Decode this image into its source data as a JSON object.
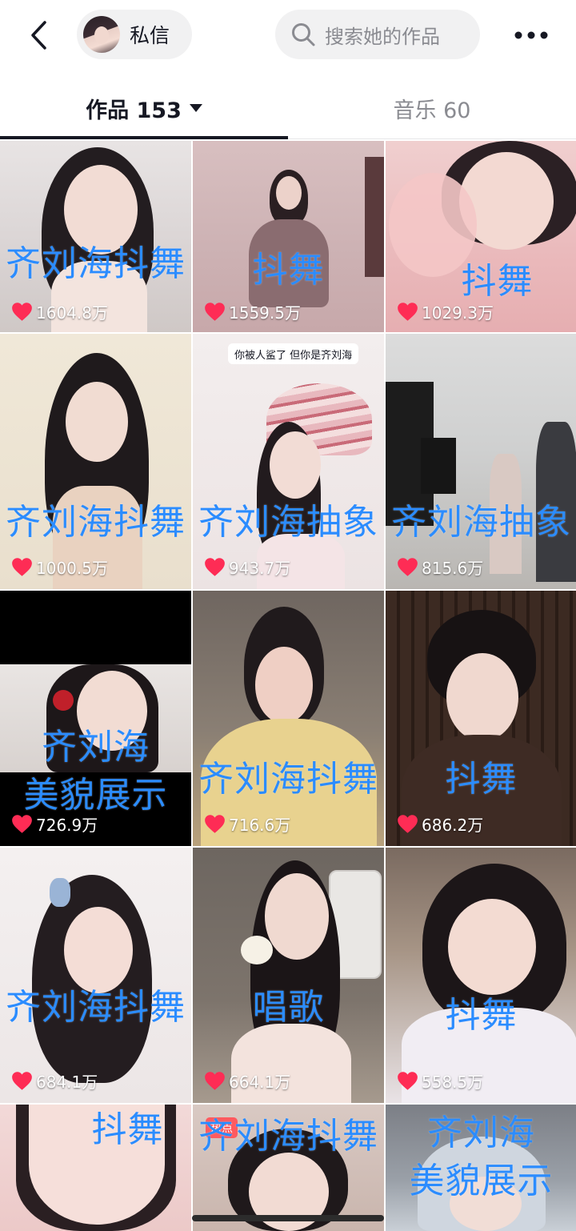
{
  "header": {
    "back_icon": "chevron-left-icon",
    "message_label": "私信",
    "search_placeholder": "搜索她的作品",
    "more_icon": "more-dots-icon"
  },
  "tabs": [
    {
      "label": "作品 153",
      "active": true
    },
    {
      "label": "音乐 60",
      "active": false
    }
  ],
  "colors": {
    "caption_blue": "#2b8cff",
    "heart_red": "#fe2c55",
    "text_primary": "#161823",
    "text_secondary": "#8a8b91"
  },
  "videos": [
    {
      "caption": "齐刘海抖舞",
      "likes": "1604.8万"
    },
    {
      "caption": "抖舞",
      "likes": "1559.5万"
    },
    {
      "caption": "抖舞",
      "likes": "1029.3万"
    },
    {
      "caption": "齐刘海抖舞",
      "likes": "1000.5万"
    },
    {
      "caption": "齐刘海抽象",
      "likes": "943.7万",
      "overlay_text": "你被人鲨了 但你是齐刘海"
    },
    {
      "caption": "齐刘海抽象",
      "likes": "815.6万"
    },
    {
      "caption_line1": "齐刘海",
      "caption_line2": "美貌展示",
      "likes": "726.9万"
    },
    {
      "caption": "齐刘海抖舞",
      "likes": "716.6万"
    },
    {
      "caption": "抖舞",
      "likes": "686.2万"
    },
    {
      "caption": "齐刘海抖舞",
      "likes": "684.1万"
    },
    {
      "caption": "唱歌",
      "likes": "664.1万"
    },
    {
      "caption": "抖舞",
      "likes": "558.5万"
    },
    {
      "caption": "抖舞"
    },
    {
      "caption": "齐刘海抖舞",
      "badge": "热点"
    },
    {
      "caption_line1": "齐刘海",
      "caption_line2": "美貌展示"
    }
  ]
}
